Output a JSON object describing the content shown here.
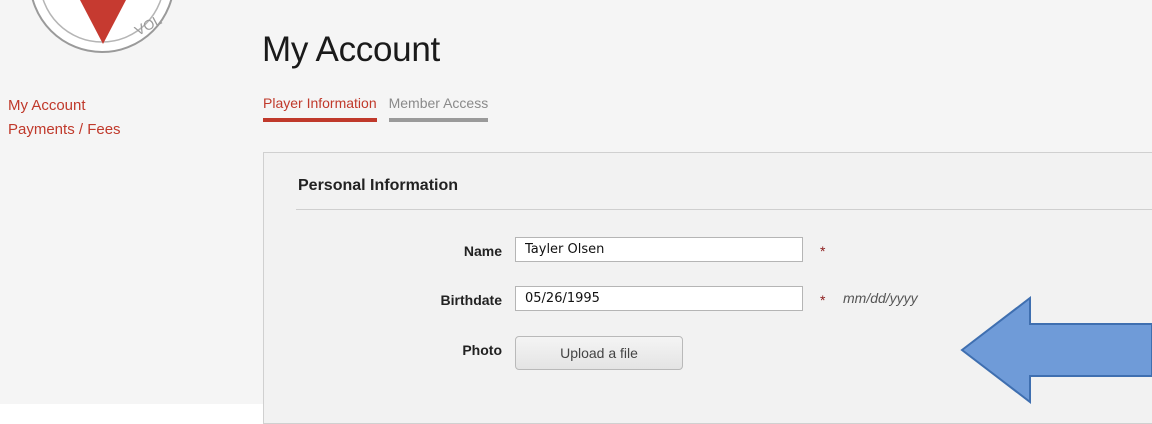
{
  "logo": {
    "text": "VOL"
  },
  "sidebar": {
    "items": [
      {
        "label": "My Account"
      },
      {
        "label": "Payments / Fees"
      }
    ]
  },
  "header": {
    "title": "My Account"
  },
  "tabs": [
    {
      "label": "Player Information",
      "active": true
    },
    {
      "label": "Member Access",
      "active": false
    }
  ],
  "personal_info": {
    "title": "Personal Information",
    "fields": {
      "name": {
        "label": "Name",
        "value": "Tayler Olsen",
        "required_mark": "*"
      },
      "birthdate": {
        "label": "Birthdate",
        "value": "05/26/1995",
        "required_mark": "*",
        "hint": "mm/dd/yyyy"
      },
      "photo": {
        "label": "Photo",
        "button_label": "Upload a file"
      }
    }
  },
  "colors": {
    "accent": "#c0392b",
    "arrow_fill": "#6f9bd8",
    "arrow_stroke": "#3f6fb0"
  }
}
